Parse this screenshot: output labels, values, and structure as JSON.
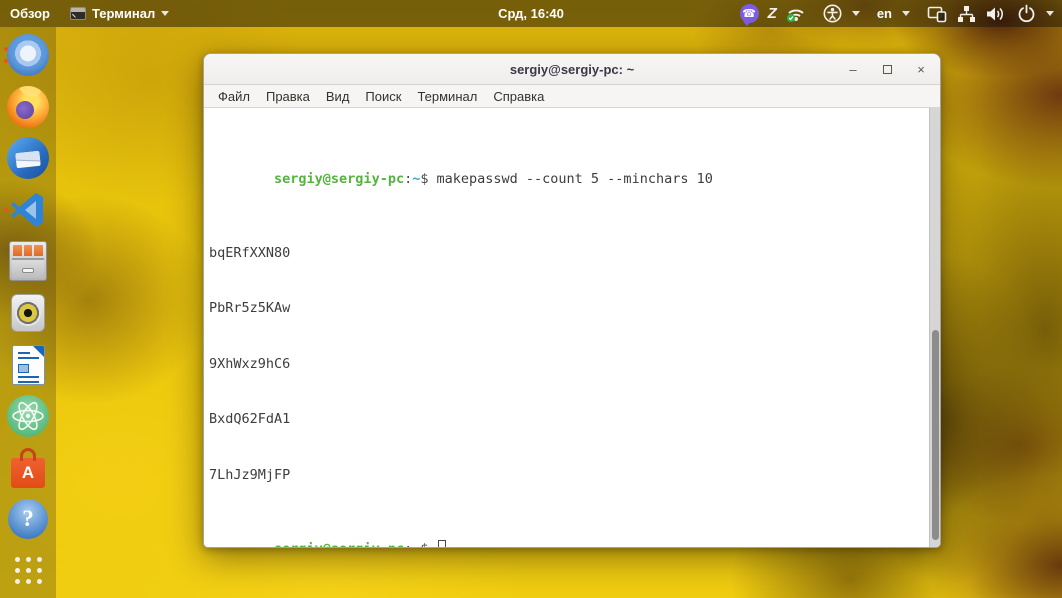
{
  "top_bar": {
    "activities_label": "Обзор",
    "app_menu_label": "Терминал",
    "clock": "Срд, 16:40",
    "language_label": "en",
    "z_app_glyph": "Z",
    "viber_glyph": "☎"
  },
  "dock": {
    "items": [
      {
        "name": "chromium",
        "running_indicators": 2
      },
      {
        "name": "firefox",
        "running_indicators": 0
      },
      {
        "name": "thunderbird",
        "running_indicators": 0
      },
      {
        "name": "vscode",
        "running_indicators": 1
      },
      {
        "name": "files",
        "running_indicators": 0
      },
      {
        "name": "rhythmbox",
        "running_indicators": 0
      },
      {
        "name": "libreoffice-writer",
        "running_indicators": 0
      },
      {
        "name": "atom",
        "running_indicators": 0
      },
      {
        "name": "ubuntu-software",
        "running_indicators": 0
      },
      {
        "name": "help",
        "running_indicators": 0
      }
    ],
    "software_letter": "A",
    "help_glyph": "?"
  },
  "window": {
    "title": "sergiy@sergiy-pc: ~",
    "controls": {
      "minimize": "–",
      "close": "×"
    },
    "menu_items": [
      "Файл",
      "Правка",
      "Вид",
      "Поиск",
      "Терминал",
      "Справка"
    ],
    "terminal": {
      "prompt": {
        "user_host": "sergiy@sergiy-pc",
        "colon": ":",
        "path": "~",
        "dollar": "$"
      },
      "command": "makepasswd --count 5 --minchars 10",
      "outputs": [
        "bqERfXXN80",
        "PbRr5z5KAw",
        "9XhWxz9hC6",
        "BxdQ62FdA1",
        "7LhJz9MjFP"
      ]
    }
  },
  "colors": {
    "accent_orange": "#e95420",
    "prompt_green": "#53b43e",
    "prompt_teal": "#3aabbd",
    "viber_purple": "#7c5ce0",
    "topbar_bg": "rgba(28,22,10,0.52)"
  }
}
